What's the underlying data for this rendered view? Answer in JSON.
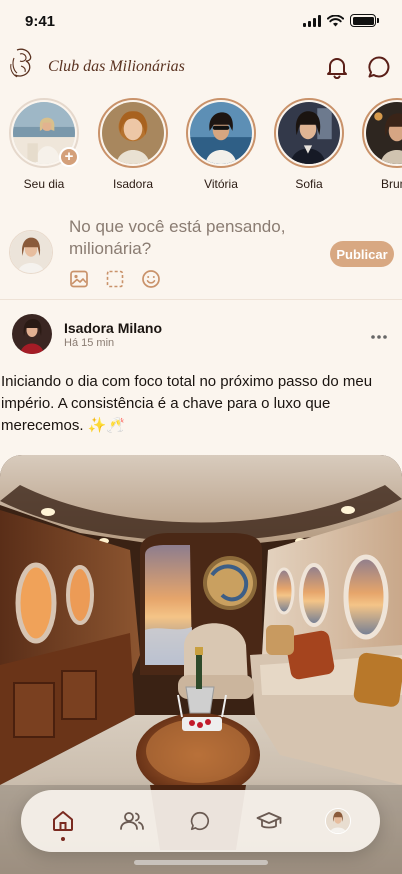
{
  "status_bar": {
    "time": "9:41"
  },
  "header": {
    "title": "Club das Milionárias"
  },
  "stories": [
    {
      "name": "Seu dia",
      "own": true
    },
    {
      "name": "Isadora"
    },
    {
      "name": "Vitória"
    },
    {
      "name": "Sofia"
    },
    {
      "name": "Bruna"
    }
  ],
  "composer": {
    "placeholder": "No que você está pensando, milionária?",
    "publish_label": "Publicar"
  },
  "post": {
    "author": "Isadora Milano",
    "time": "Há 15 min",
    "text": "Iniciando o dia com foco total no próximo passo do meu império. A consistência é a chave para o luxo que merecemos. ✨🥂"
  },
  "bottom_nav": {
    "items": [
      "home-icon",
      "people-icon",
      "chat-icon",
      "graduation-cap-icon",
      "profile-avatar"
    ],
    "active": "home-icon"
  },
  "colors": {
    "background": "#fbf5ee",
    "accent": "#d8a882",
    "brand_dark": "#5a3220"
  }
}
